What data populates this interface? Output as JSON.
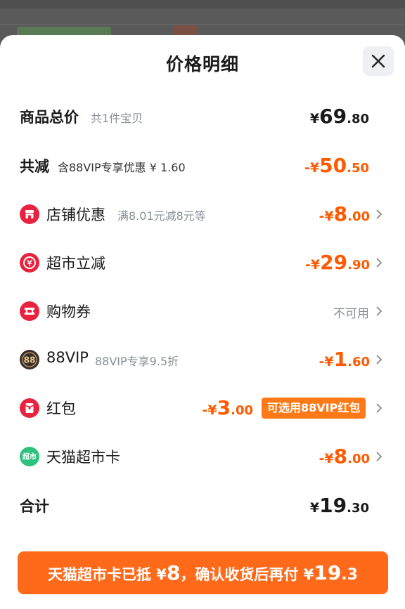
{
  "sheet": {
    "title": "价格明细"
  },
  "rows": {
    "total_items": {
      "label": "商品总价",
      "sub": "共1件宝贝",
      "sym": "¥",
      "int": "69",
      "dec": ".80"
    },
    "total_reduction": {
      "label": "共减",
      "sub": "含88VIP专享优惠 ¥ 1.60",
      "sym": "-¥",
      "int": "50",
      "dec": ".50"
    },
    "store_discount": {
      "label": "店铺优惠",
      "sub": "满8.01元减8元等",
      "sym": "-¥",
      "int": "8",
      "dec": ".00",
      "icon": "store-icon"
    },
    "market_reduction": {
      "label": "超市立减",
      "sym": "-¥",
      "int": "29",
      "dec": ".90",
      "icon": "yuan-down-icon"
    },
    "shopping_coupon": {
      "label": "购物券",
      "status": "不可用",
      "icon": "ticket-icon"
    },
    "vip": {
      "label": "88VIP",
      "sub": "88VIP专享9.5折",
      "sym": "-¥",
      "int": "1",
      "dec": ".60",
      "icon": "88vip-icon",
      "icon_text": "88"
    },
    "red_packet": {
      "label": "红包",
      "sym": "-¥",
      "int": "3",
      "dec": ".00",
      "tag": "可选用88VIP红包",
      "icon": "red-packet-icon"
    },
    "tmall_card": {
      "label": "天猫超市卡",
      "sym": "-¥",
      "int": "8",
      "dec": ".00",
      "icon": "tmall-market-icon",
      "icon_text": "超市"
    },
    "grand_total": {
      "label": "合计",
      "sym": "¥",
      "int": "19",
      "dec": ".30"
    }
  },
  "cta": {
    "part1": "天猫超市卡已抵 ¥",
    "amount1": "8",
    "part2": "，确认收货后再付 ¥",
    "amount2_int": "19",
    "amount2_dec": ".3"
  },
  "colors": {
    "accent": "#ff5a00",
    "cta_bg": "#ff6a1a",
    "icon_red": "#e8233f",
    "tmall_green": "#2ec27e",
    "vip_dark": "#3a2f2a"
  }
}
